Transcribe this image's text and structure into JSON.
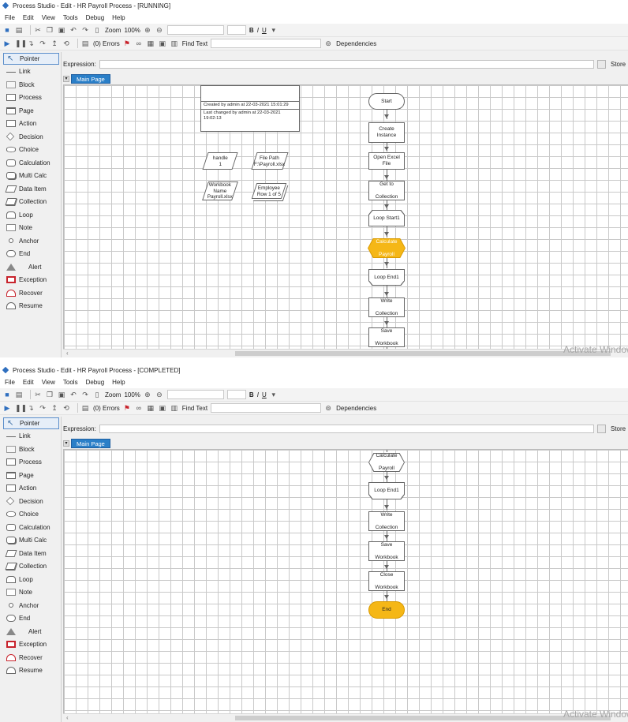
{
  "menu": [
    "File",
    "Edit",
    "View",
    "Tools",
    "Debug",
    "Help"
  ],
  "toolbar": {
    "zoom_label": "Zoom",
    "zoom_value": "100%",
    "bold": "B",
    "italic": "I",
    "underline": "U",
    "errors": "(0) Errors",
    "find_text": "Find Text",
    "dependencies": "Dependencies"
  },
  "toolbox": [
    "Pointer",
    "Link",
    "Block",
    "Process",
    "Page",
    "Action",
    "Decision",
    "Choice",
    "Calculation",
    "Multi Calc",
    "Data Item",
    "Collection",
    "Loop",
    "Note",
    "Anchor",
    "End",
    "Alert",
    "Exception",
    "Recover",
    "Resume"
  ],
  "expression_label": "Expression:",
  "store_label": "Store",
  "tab_label": "Main Page",
  "watermark": "Activate Windows",
  "windows": [
    {
      "title": "Process Studio - Edit - HR Payroll Process - [RUNNING]",
      "info": {
        "created": "Created by admin at 22-03-2021 15:01:29",
        "changed": "Last changed by admin at 22-03-2021 19:02:13"
      },
      "data_items": {
        "handle": [
          "handle",
          "1"
        ],
        "file_path": [
          "File Path",
          "F:\\Payroll.xlsx"
        ],
        "workbook_name": [
          "Workbook",
          "Name",
          "Payroll.xlsx"
        ],
        "employee": [
          "Employee",
          "Row 1 of 5"
        ]
      },
      "flow": {
        "start": "Start",
        "create_instance": "Create Instance",
        "open_excel": "Open Excel File",
        "get_collection": [
          "Get to",
          "Collection"
        ],
        "loop_start": "Loop Start1",
        "calc_payroll": [
          "Calculate",
          "Payroll"
        ],
        "loop_end": "Loop End1",
        "write_collection": [
          "Write",
          "Collection"
        ],
        "save_workbook": [
          "Save",
          "Workbook"
        ]
      }
    },
    {
      "title": "Process Studio - Edit - HR Payroll Process - [COMPLETED]",
      "flow": {
        "calc_payroll": [
          "Calculate",
          "Payroll"
        ],
        "loop_end": "Loop End1",
        "write_collection": [
          "Write",
          "Collection"
        ],
        "save_workbook": [
          "Save",
          "Workbook"
        ],
        "close_workbook": [
          "Close",
          "Workbook"
        ],
        "end": "End"
      }
    }
  ],
  "colors": {
    "tab_blue": "#2a7fc8",
    "highlight_orange": "#f5b716",
    "grid_line": "#c9c9c9",
    "exception_red": "#c8232c"
  }
}
